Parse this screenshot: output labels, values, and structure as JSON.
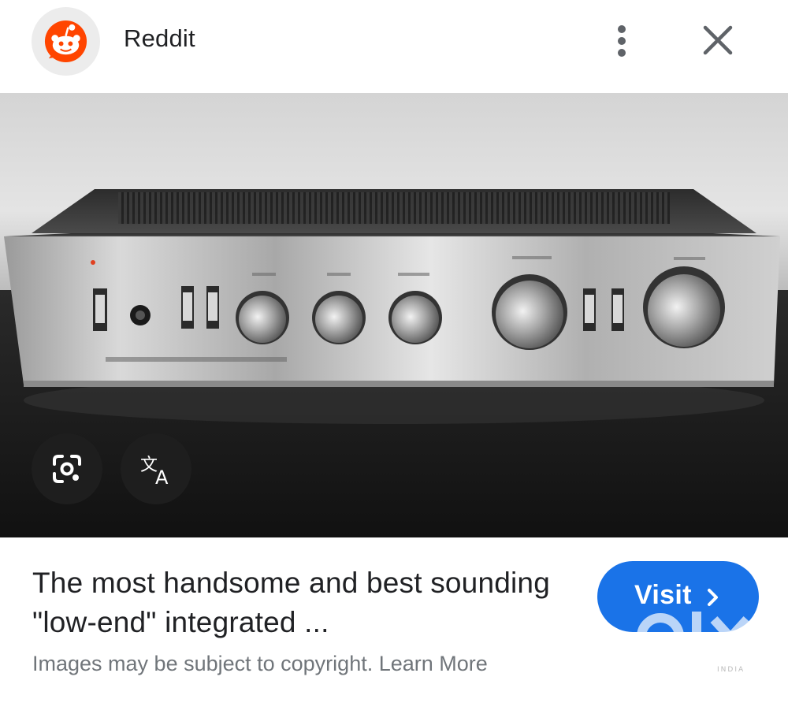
{
  "header": {
    "source_name": "Reddit",
    "logo_icon": "reddit-snoo-icon",
    "more_icon": "more-vert-icon",
    "close_icon": "close-icon"
  },
  "image": {
    "actions": [
      {
        "icon": "google-lens-icon"
      },
      {
        "icon": "translate-icon"
      }
    ]
  },
  "result": {
    "title": "The most handsome and best sounding \"low-end\" integrated ...",
    "copyright_prefix": "Images may be subject to copyright. ",
    "learn_more": "Learn More",
    "visit_label": "Visit",
    "visit_icon": "chevron-right-icon"
  },
  "watermark": {
    "text": "OLX",
    "sub": "INDIA"
  },
  "colors": {
    "accent": "#1a73e8",
    "reddit": "#ff4500",
    "text_primary": "#202124",
    "text_secondary": "#70757a"
  }
}
